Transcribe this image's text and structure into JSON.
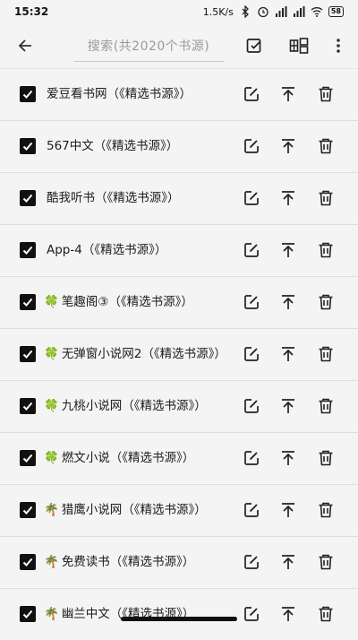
{
  "status": {
    "time": "15:32",
    "speed": "1.5K/s",
    "battery": "58"
  },
  "toolbar": {
    "search_placeholder": "搜索(共2020个书源)"
  },
  "items": [
    {
      "emoji": "",
      "name": "爱豆看书网（《精选书源》）"
    },
    {
      "emoji": "",
      "name": "567中文（《精选书源》）"
    },
    {
      "emoji": "",
      "name": "酷我听书（《精选书源》）"
    },
    {
      "emoji": "",
      "name": "App-4（《精选书源》）"
    },
    {
      "emoji": "🍀",
      "name": "笔趣阁③（《精选书源》）"
    },
    {
      "emoji": "🍀",
      "name": "无弹窗小说网2（《精选书源》）"
    },
    {
      "emoji": "🍀",
      "name": "九桃小说网（《精选书源》）"
    },
    {
      "emoji": "🍀",
      "name": "燃文小说（《精选书源》）"
    },
    {
      "emoji": "🌴",
      "name": "猎鹰小说网（《精选书源》）"
    },
    {
      "emoji": "🌴",
      "name": "免费读书（《精选书源》）"
    },
    {
      "emoji": "🌴",
      "name": "幽兰中文（《精选书源》）"
    }
  ]
}
